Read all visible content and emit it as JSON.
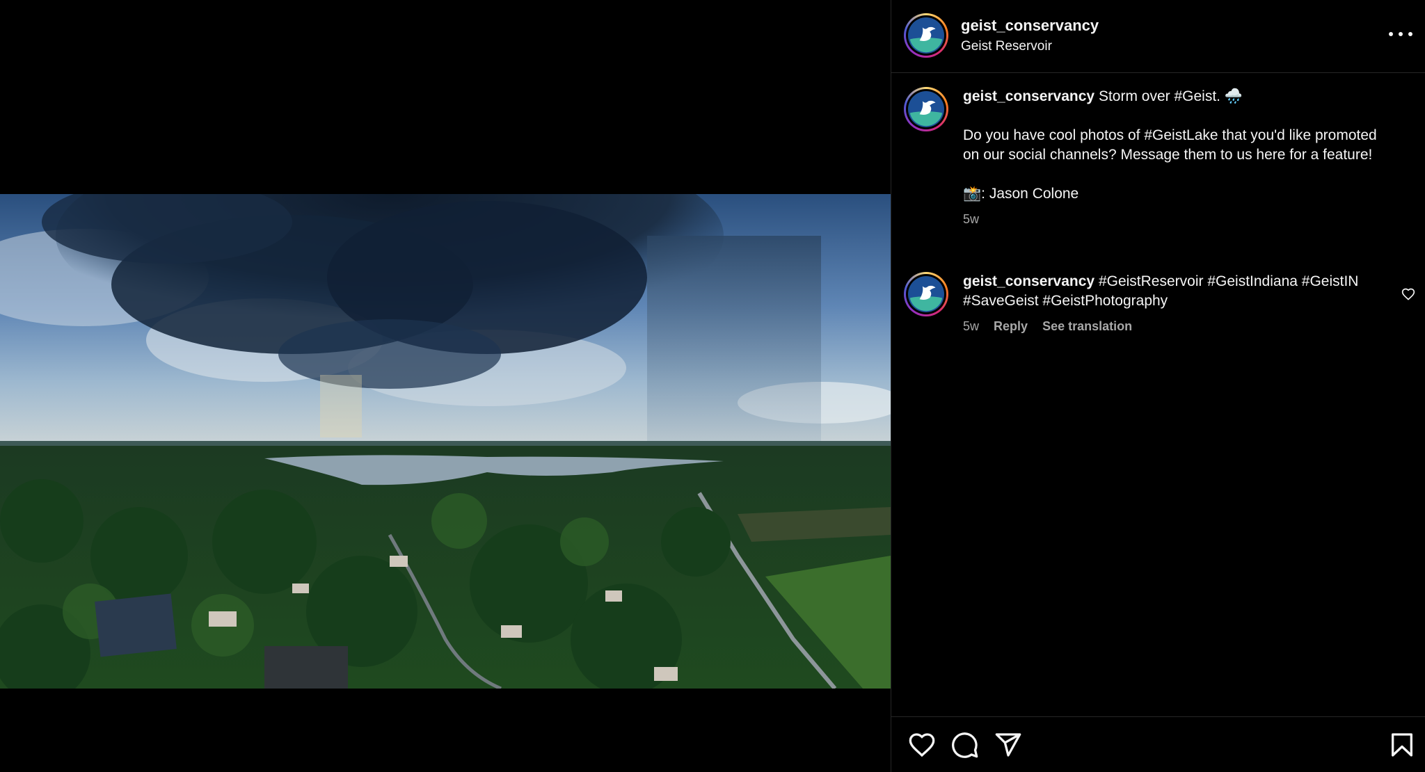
{
  "post": {
    "username": "geist_conservancy",
    "location": "Geist Reservoir",
    "photo_alt": "Aerial view of storm clouds over Geist Reservoir"
  },
  "caption": {
    "username": "geist_conservancy",
    "first_line": "Storm over #Geist. 🌧️",
    "paragraph": "Do you have cool photos of #GeistLake that you'd like promoted on our social channels? Message them to us here for a feature!",
    "credit": "📸: Jason Colone",
    "time": "5w"
  },
  "comment": {
    "username": "geist_conservancy",
    "text": "#GeistReservoir #GeistIndiana #GeistIN #SaveGeist #GeistPhotography",
    "time": "5w",
    "reply_label": "Reply",
    "translate_label": "See translation"
  },
  "icons": {
    "more": "more-horizontal-icon",
    "like": "heart-icon",
    "comment": "comment-bubble-icon",
    "share": "send-icon",
    "save": "bookmark-icon"
  },
  "colors": {
    "background": "#000000",
    "text": "#f5f5f5",
    "muted": "#a8a8a8",
    "divider": "#262626"
  }
}
